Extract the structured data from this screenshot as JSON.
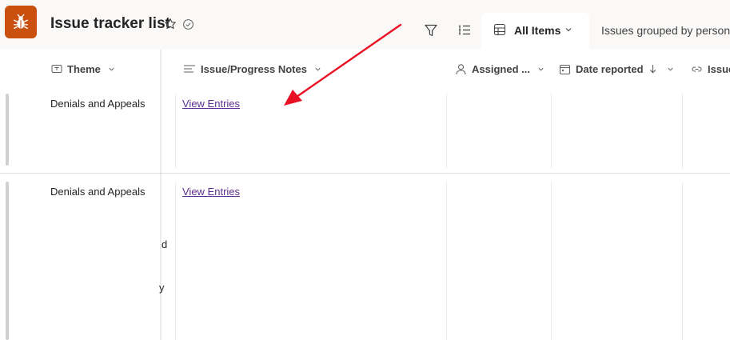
{
  "header": {
    "app_icon": "bug-icon",
    "title": "Issue tracker list",
    "accent_color": "#ca5010",
    "views": {
      "active": "All Items",
      "other": "Issues grouped by person"
    }
  },
  "columns": [
    {
      "label": "Theme",
      "icon": "text-field-icon"
    },
    {
      "label": "Issue/Progress Notes",
      "icon": "multiline-text-icon"
    },
    {
      "label": "Assigned ...",
      "icon": "person-icon"
    },
    {
      "label": "Date reported",
      "icon": "calendar-icon",
      "sort": "descending"
    },
    {
      "label": "Issue",
      "icon": "link-icon"
    }
  ],
  "rows": [
    {
      "theme": "Denials and Appeals",
      "notes_link": "View Entries"
    },
    {
      "theme": "Denials and Appeals",
      "notes_link": "View Entries",
      "clipped_fragments": [
        "d",
        "y"
      ]
    }
  ],
  "annotation": {
    "type": "arrow",
    "color": "#e81123"
  }
}
